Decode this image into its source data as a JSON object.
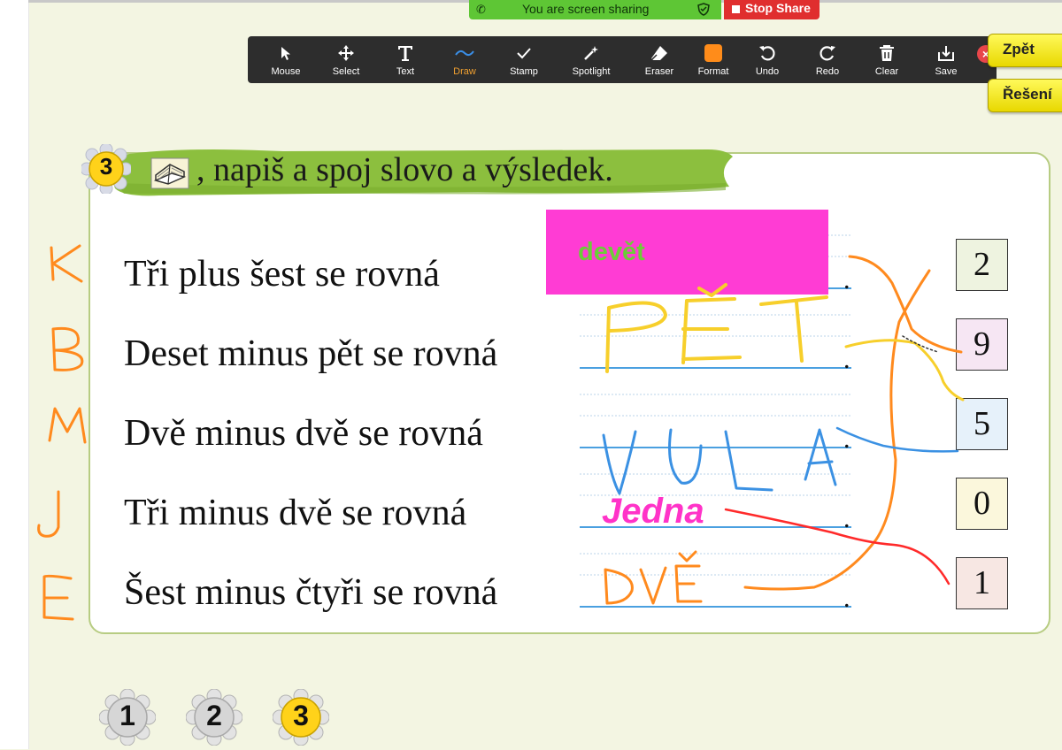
{
  "share": {
    "status_text": "You are screen sharing",
    "stop_label": "Stop Share"
  },
  "toolbar": {
    "tools": [
      {
        "label": "Mouse",
        "icon": "cursor-icon"
      },
      {
        "label": "Select",
        "icon": "move-icon"
      },
      {
        "label": "Text",
        "icon": "text-icon"
      },
      {
        "label": "Draw",
        "icon": "draw-icon",
        "active": true
      },
      {
        "label": "Stamp",
        "icon": "checkmark-icon"
      },
      {
        "label": "Spotlight",
        "icon": "spotlight-icon"
      },
      {
        "label": "Eraser",
        "icon": "eraser-icon"
      },
      {
        "label": "Format",
        "icon": "format-color-icon",
        "color": "#ff8c1a"
      },
      {
        "label": "Undo",
        "icon": "undo-icon"
      },
      {
        "label": "Redo",
        "icon": "redo-icon"
      },
      {
        "label": "Clear",
        "icon": "trash-icon"
      },
      {
        "label": "Save",
        "icon": "save-icon"
      }
    ],
    "close": "×"
  },
  "nav": {
    "back": "Zpět",
    "solution": "Řešení"
  },
  "task": {
    "number": "3",
    "title": ", napiš a spoj slovo a výsledek.",
    "rows": [
      {
        "letter": "K",
        "text": "Tři plus šest se rovná",
        "dot": "."
      },
      {
        "letter": "B",
        "text": "Deset minus pět se rovná",
        "dot": "."
      },
      {
        "letter": "M",
        "text": "Dvě minus dvě se rovná",
        "dot": "."
      },
      {
        "letter": "J",
        "text": "Tři minus dvě se rovná",
        "dot": "."
      },
      {
        "letter": "E",
        "text": "Šest minus čtyři se rovná",
        "dot": "."
      }
    ],
    "results": [
      {
        "value": "2",
        "bg": "#eef3e0"
      },
      {
        "value": "9",
        "bg": "#f6e6f3"
      },
      {
        "value": "5",
        "bg": "#e6f1fa"
      },
      {
        "value": "0",
        "bg": "#fbf7dc"
      },
      {
        "value": "1",
        "bg": "#f7e7e3"
      }
    ]
  },
  "annotations": {
    "typed_answer_1": "devět",
    "handwritten_answer_2": "PĚT",
    "handwritten_answer_3": "NULA",
    "typed_answer_4": "Jedna",
    "handwritten_answer_5": "DVĚ"
  },
  "pages": [
    "1",
    "2",
    "3"
  ]
}
